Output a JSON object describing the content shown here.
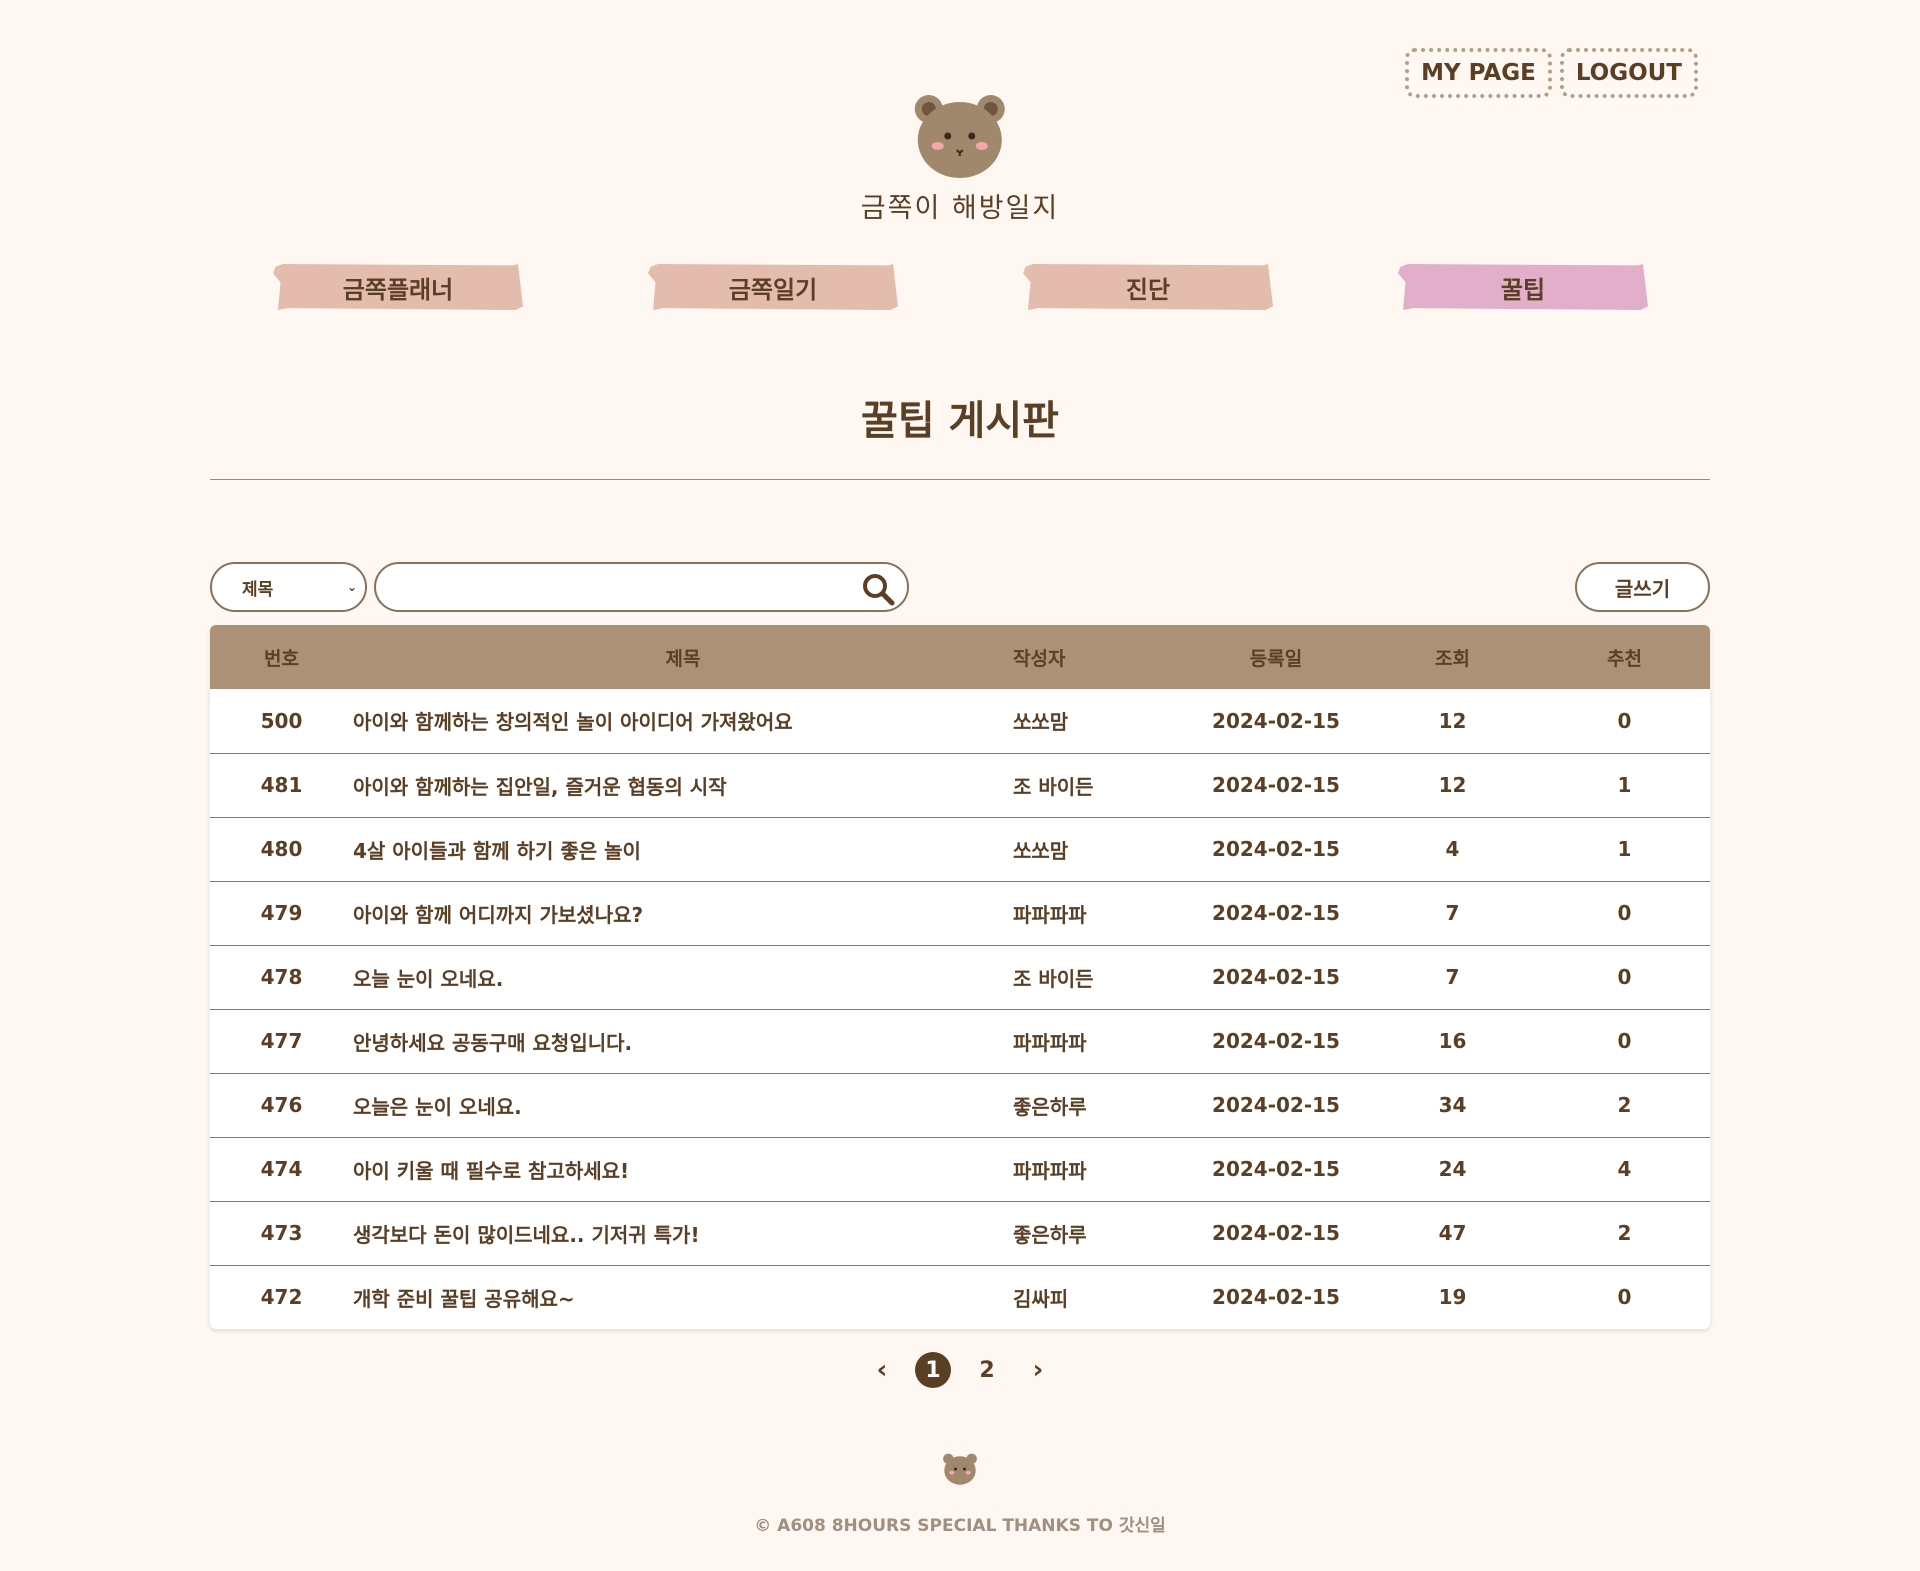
{
  "header": {
    "mypage_label": "MY PAGE",
    "logout_label": "LOGOUT",
    "logo_text": "금쪽이 해방일지"
  },
  "nav": {
    "items": [
      {
        "label": "금쪽플래너"
      },
      {
        "label": "금쪽일기"
      },
      {
        "label": "진단"
      },
      {
        "label": "꿀팁"
      }
    ],
    "active_index": 3
  },
  "page": {
    "title": "꿀팁 게시판"
  },
  "search": {
    "select_value": "제목",
    "input_value": "",
    "write_label": "글쓰기"
  },
  "table": {
    "headers": [
      "번호",
      "제목",
      "작성자",
      "등록일",
      "조회",
      "추천"
    ],
    "rows": [
      {
        "num": "500",
        "title": "아이와 함께하는 창의적인 놀이 아이디어 가져왔어요",
        "author": "쏘쏘맘",
        "date": "2024-02-15",
        "views": "12",
        "rec": "0"
      },
      {
        "num": "481",
        "title": "아이와 함께하는 집안일, 즐거운 협동의 시작",
        "author": "조 바이든",
        "date": "2024-02-15",
        "views": "12",
        "rec": "1"
      },
      {
        "num": "480",
        "title": "4살 아이들과 함께 하기 좋은 놀이",
        "author": "쏘쏘맘",
        "date": "2024-02-15",
        "views": "4",
        "rec": "1"
      },
      {
        "num": "479",
        "title": "아이와 함께 어디까지 가보셨나요?",
        "author": "파파파파",
        "date": "2024-02-15",
        "views": "7",
        "rec": "0"
      },
      {
        "num": "478",
        "title": "오늘 눈이 오네요.",
        "author": "조 바이든",
        "date": "2024-02-15",
        "views": "7",
        "rec": "0"
      },
      {
        "num": "477",
        "title": "안녕하세요 공동구매 요청입니다.",
        "author": "파파파파",
        "date": "2024-02-15",
        "views": "16",
        "rec": "0"
      },
      {
        "num": "476",
        "title": "오늘은 눈이 오네요.",
        "author": "좋은하루",
        "date": "2024-02-15",
        "views": "34",
        "rec": "2"
      },
      {
        "num": "474",
        "title": "아이 키울 때 필수로 참고하세요!",
        "author": "파파파파",
        "date": "2024-02-15",
        "views": "24",
        "rec": "4"
      },
      {
        "num": "473",
        "title": "생각보다 돈이 많이드네요.. 기저귀 특가!",
        "author": "좋은하루",
        "date": "2024-02-15",
        "views": "47",
        "rec": "2"
      },
      {
        "num": "472",
        "title": "개학 준비 꿀팁 공유해요~",
        "author": "김싸피",
        "date": "2024-02-15",
        "views": "19",
        "rec": "0"
      }
    ]
  },
  "pagination": {
    "prev_icon": "chevron-left-icon",
    "next_icon": "chevron-right-icon",
    "pages": [
      "1",
      "2"
    ],
    "current": "1"
  },
  "footer": {
    "text": "© A608 8HOURS SPECIAL THANKS TO 갓신일"
  },
  "colors": {
    "background": "#fff7f2",
    "text": "#5a3f24",
    "header_row": "#ab9175",
    "tape": "#e4bcae",
    "tape_active": "#e1afc9"
  }
}
